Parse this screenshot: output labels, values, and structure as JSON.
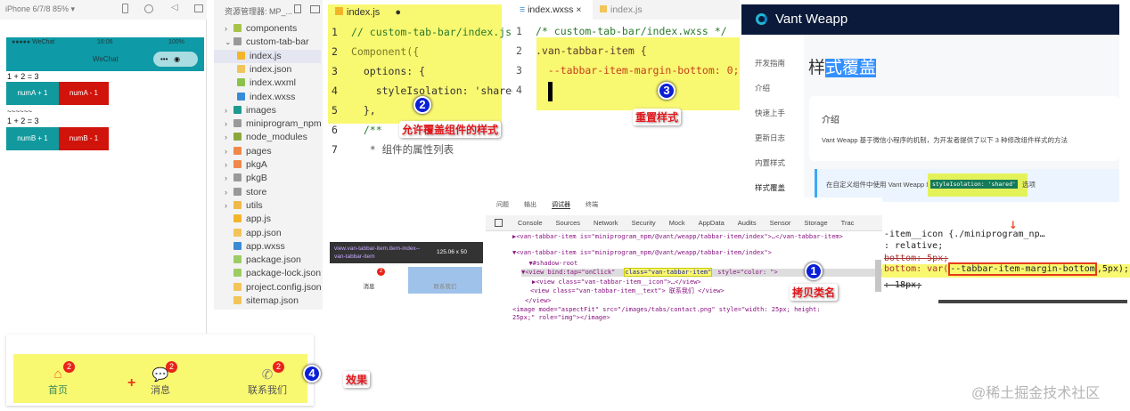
{
  "simulator": {
    "device": "iPhone 6/7/8 85% ▾",
    "status_left": "●●●●● WeChat",
    "status_time": "16:06",
    "status_battery": "100%",
    "nav_title": "WeChat",
    "eq1": "1 + 2 = 3",
    "btn_a_plus": "numA + 1",
    "btn_a_minus": "numA - 1",
    "separator": "~~~~~~",
    "eq2": "1 + 2 = 3",
    "btn_b_plus": "numB + 1",
    "btn_b_minus": "numB - 1"
  },
  "explorer": {
    "title": "资源管理器: MP_...",
    "items": [
      "components",
      "custom-tab-bar",
      "index.js",
      "index.json",
      "index.wxml",
      "index.wxss",
      "images",
      "miniprogram_npm",
      "node_modules",
      "pages",
      "pkgA",
      "pkgB",
      "store",
      "utils",
      "app.js",
      "app.json",
      "app.wxss",
      "package.json",
      "package-lock.json",
      "project.config.json",
      "sitemap.json"
    ]
  },
  "editor_js": {
    "tab": "index.js",
    "lines": [
      "// custom-tab-bar/index.js",
      "Component({",
      "  options: {",
      "    styleIsolation: 'shared'",
      "  },",
      "  /**",
      "   * 组件的属性列表"
    ],
    "note": "允许覆盖组件的样式",
    "step": "2"
  },
  "editor_wxss": {
    "tab_active": "index.wxss",
    "tab_other": "index.js",
    "lines": [
      "/* custom-tab-bar/index.wxss */",
      ".van-tabbar-item {",
      "  --tabbar-item-margin-bottom: 0;",
      ""
    ],
    "note": "重置样式",
    "step": "3"
  },
  "vant": {
    "brand": "Vant Weapp",
    "nav": [
      "开发指南",
      "介绍",
      "快速上手",
      "更新日志",
      "内置样式",
      "样式覆盖"
    ],
    "title_prefix": "样",
    "title_selected": "式覆盖",
    "card_title": "介绍",
    "card_text": "Vant Weapp 基于微信小程序的机制，为开发者提供了以下 3 种修改组件样式的方法",
    "tip_text": "在自定义组件中使用 Vant Weapp 组件时，需开启",
    "tip_code": "styleIsolation: 'shared'",
    "tip_suffix": "选项"
  },
  "inspector_tooltip": {
    "selector": "view.van-tabbar-item.item-index--van-tabbar-item",
    "size": "125.06 x 50",
    "tab1": "消息",
    "tab2": "联系我们",
    "badge": "2"
  },
  "devtools": {
    "top_tabs": [
      "问题",
      "输出",
      "调试器",
      "终端"
    ],
    "tabs": [
      "Console",
      "Sources",
      "Network",
      "Security",
      "Mock",
      "AppData",
      "Audits",
      "Sensor",
      "Storage",
      "Trac"
    ],
    "lines": [
      "▶<van-tabbar-item is=\"miniprogram_npm/@vant/weapp/tabbar-item/index\">…</van-tabbar-item>",
      "▼<van-tabbar-item is=\"miniprogram_npm/@vant/weapp/tabbar-item/index\">",
      "  ▼#shadow-root",
      "▼<view bind:tap=\"onClick\"",
      "▶<view class=\"van-tabbar-item__icon\">…</view>",
      "<view class=\"van-tabbar-item__text\"> 联系我们 </view>",
      "</view>",
      "<image mode=\"aspectFit\" src=\"/images/tabs/contact.png\" style=\"width: 25px; height: 25px;\" role=\"img\"></image>"
    ],
    "highlight": "class=\"van-tabbar-item\"",
    "after_highlight": "style=\"color: \">",
    "note": "拷贝类名",
    "step": "1"
  },
  "styles_pane": {
    "lines": [
      "-item__icon {./miniprogram_np…",
      ": relative;",
      "bottom: 5px;",
      "bottom: var(",
      "--tabbar-item-margin-bottom",
      ",5px);",
      ": 18px;"
    ]
  },
  "tabbar": {
    "items": [
      {
        "label": "首页",
        "badge": "2"
      },
      {
        "label": "消息",
        "badge": "2"
      },
      {
        "label": "联系我们",
        "badge": "2"
      }
    ],
    "plus": "+",
    "step": "4",
    "note": "效果"
  },
  "watermark": "@稀土掘金技术社区",
  "colors": {
    "teal": "#0e9aa7",
    "red": "#d51a0f",
    "highlight": "#f9f871",
    "vant_dark": "#0b1a3a",
    "orange": "#f1662b"
  }
}
